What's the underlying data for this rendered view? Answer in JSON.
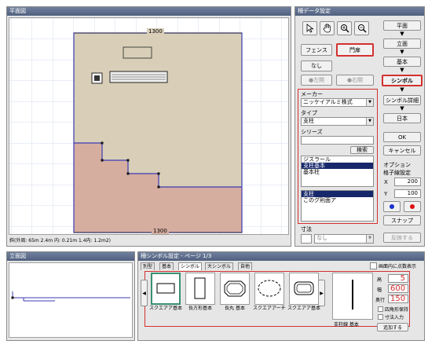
{
  "plan_window": {
    "title": "平面図"
  },
  "canvas": {
    "dim_top": "1300",
    "dim_bottom": "1300",
    "status": "斜(外周: 65m 2.4m 内: 0.21m 1.4内: 1.2m2)"
  },
  "elev_window": {
    "title": "立面図"
  },
  "data_window": {
    "title": "柵データ設定",
    "tool_icons": [
      "arrow-cursor-icon",
      "hand-icon",
      "zoom-in-icon",
      "zoom-out-icon"
    ],
    "type_buttons": {
      "fence": "フェンス",
      "gate": "門扉"
    },
    "nashi": "なし",
    "radio1": "●左開",
    "radio2": "●右開",
    "maker_label": "メーカー",
    "maker_value": "ニッケイアルミ株式",
    "type_label": "タイプ",
    "type_value": "支柱",
    "series_label": "シリーズ",
    "series_value": "",
    "search_label": "検索",
    "series_list": [
      "ジスラール",
      "支柱基本",
      "基本柱"
    ],
    "series_selected": 1,
    "color_list": [
      "支柱",
      "このグ則面ア"
    ],
    "color_selected": 0,
    "size_label": "寸法",
    "size_value": "なし"
  },
  "steps": {
    "items": [
      "平面",
      "立面",
      "基本",
      "シンボル",
      "シンボル詳細",
      "日本"
    ],
    "active": 3,
    "ok": "OK",
    "cancel": "キャンセル",
    "options_title": "オプション",
    "options_sub": "格子線設定",
    "x_label": "X",
    "x_value": "200",
    "y_label": "Y",
    "y_value": "100",
    "dot_blue": "#1a2fd0",
    "dot_red": "#dd1010",
    "snap": "スナップ",
    "reflect": "反映する"
  },
  "symbol_window": {
    "title": "柵シンボル設定 - ページ 1/3",
    "tabs": [
      "別型",
      "基本",
      "シンボル",
      "大シンボル",
      "自他"
    ],
    "active_tab": 2,
    "check_label": "画面内に点数表示",
    "thumbs": [
      {
        "label": "スクエアア基本",
        "icon": "rectangle-symbol-icon"
      },
      {
        "label": "長方形基本",
        "icon": "tall-rectangle-symbol-icon"
      },
      {
        "label": "長丸 基本",
        "icon": "octagon-symbol-icon"
      },
      {
        "label": "スクエアアーチ基本",
        "icon": "dashed-oval-symbol-icon"
      },
      {
        "label": "スクエアア基本",
        "icon": "rounded-symbol-icon"
      }
    ],
    "selected_thumb": 0,
    "preview_label": "支柱線 基本",
    "fields": [
      {
        "label": "高",
        "value": "5"
      },
      {
        "label": "幅",
        "value": "600"
      },
      {
        "label": "奥行",
        "value": "150"
      }
    ],
    "check1": "四角形保持",
    "check2": "寸法入力",
    "save_button": "追加する",
    "nav_prev": "◀",
    "nav_next": "▶"
  }
}
